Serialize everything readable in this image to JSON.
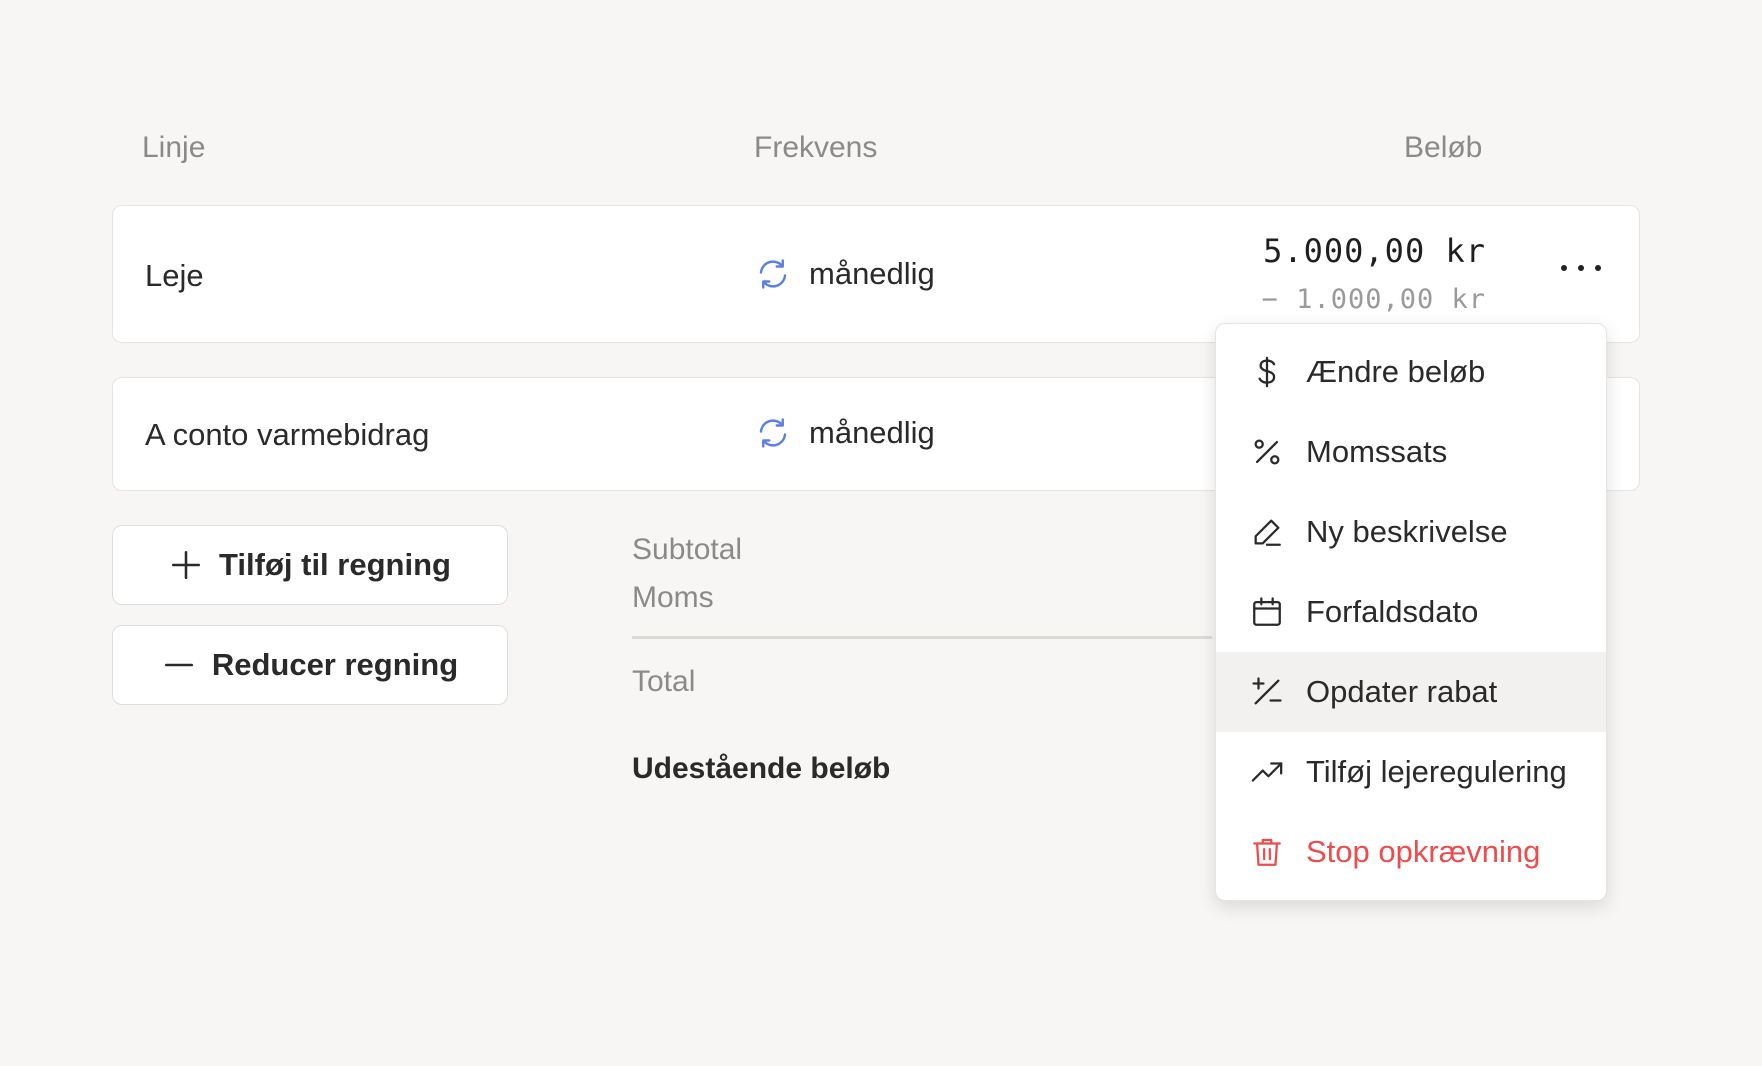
{
  "table": {
    "headers": {
      "line": "Linje",
      "frequency": "Frekvens",
      "amount": "Beløb"
    },
    "rows": [
      {
        "name": "Leje",
        "frequency": "månedlig",
        "amount": "5.000,00 kr",
        "discount": "− 1.000,00 kr"
      },
      {
        "name": "A conto varmebidrag",
        "frequency": "månedlig"
      }
    ]
  },
  "actions": {
    "add": "Tilføj til regning",
    "reduce": "Reducer regning"
  },
  "summary": {
    "subtotal": "Subtotal",
    "vat": "Moms",
    "total": "Total",
    "outstanding": "Udestående beløb"
  },
  "menu": {
    "items": [
      {
        "label": "Ændre beløb",
        "icon": "dollar-icon"
      },
      {
        "label": "Momssats",
        "icon": "percent-icon"
      },
      {
        "label": "Ny beskrivelse",
        "icon": "pencil-icon"
      },
      {
        "label": "Forfaldsdato",
        "icon": "calendar-icon"
      },
      {
        "label": "Opdater rabat",
        "icon": "plus-minus-icon",
        "state": "hovered"
      },
      {
        "label": "Tilføj lejeregulering",
        "icon": "trending-up-icon"
      },
      {
        "label": "Stop opkrævning",
        "icon": "trash-icon",
        "color": "#ee4c4c"
      }
    ]
  },
  "colors": {
    "accent_icon": "#5b7fe6",
    "danger": "#ee4c4c",
    "background": "#f7f6f4"
  }
}
